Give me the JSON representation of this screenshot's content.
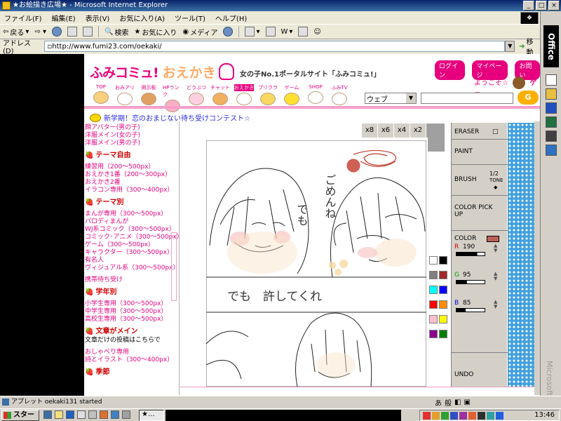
{
  "window": {
    "title": "★お絵描き広場★ - Microsoft Internet Explorer",
    "min": "_",
    "max": "□",
    "close": "×"
  },
  "menu": [
    "ファイル(F)",
    "編集(E)",
    "表示(V)",
    "お気に入り(A)",
    "ツール(T)",
    "ヘルプ(H)"
  ],
  "toolbar": {
    "back": "戻る",
    "search": "検索",
    "favorites": "お気に入り",
    "media": "メディア"
  },
  "address": {
    "label": "アドレス(D)",
    "url": "http://www.fumi23.com/oekaki/",
    "go": "移動"
  },
  "site": {
    "logo_main": "ふみコミュ!",
    "logo_sub": "おえかき",
    "tagline": "女の子No.1ポータルサイト「ふみコミュ!」",
    "top_links": [
      "ログイン",
      "マイページ",
      "お問い"
    ],
    "welcome": "ようこそ☆",
    "welcome_name": "ゲス",
    "nav": [
      "TOP",
      "おみアリ",
      "掲示板",
      "HPランク",
      "どうぶつ",
      "チャット",
      "おえかき",
      "プリクラ",
      "ゲーム",
      "SHOP",
      "ふみTV"
    ],
    "search_select": "ウェブ",
    "search_button": "G",
    "news": "新学期！恋のおまじない待ち受けコンテスト☆"
  },
  "sidebar": {
    "links_top": [
      "顔アバター(男の子)",
      "洋服メイン(女の子)",
      "洋服メイン(男の子)"
    ],
    "sections": [
      {
        "title": "テーマ自由",
        "items": [
          "練習用（200〜500px）",
          "おえかき1番（200〜300px）",
          "おえかき2番",
          "イラコン専用（300〜400px）"
        ]
      },
      {
        "title": "テーマ別",
        "items": [
          "まんが専用（300〜500px）",
          "パロディまんが",
          "WJ系コミック（300〜500px）",
          "コミック･アニメ（300〜500px）",
          "ゲーム（300〜500px）",
          "キャラクター（300〜500px）",
          "有名人",
          "ヴィジュアル系（300〜500px）"
        ]
      },
      {
        "title": "",
        "items": [
          "携帯待ち受け"
        ]
      },
      {
        "title": "学年別",
        "items": [
          "小学生専用（300〜500px）",
          "中学生専用（300〜500px）",
          "高校生専用（300〜500px）"
        ]
      },
      {
        "title": "文章がメイン",
        "note": "文章だけの投稿はこちらで",
        "items": [
          "おしゃべり専用",
          "詩とイラスト（300〜400px）"
        ]
      },
      {
        "title": "季節"
      }
    ]
  },
  "oekaki": {
    "zoom": [
      "x8",
      "x6",
      "x4",
      "x2",
      "x1"
    ],
    "zoom_selected": "x1",
    "drawing_text": {
      "vertical_left": "でも",
      "vertical_right": "ごめんね",
      "bottom": "でも　許してくれ"
    },
    "tools": {
      "eraser": "ERASER",
      "eraser_mark": "□",
      "paint": "PAINT",
      "brush": "BRUSH",
      "brush_sizes": "1/2",
      "tone": "TONE",
      "color_pick": "COLOR PICK UP",
      "color": "COLOR",
      "r_label": "R",
      "r_value": "190",
      "g_label": "G",
      "g_value": "95",
      "b_label": "B",
      "b_value": "85",
      "undo": "UNDO"
    },
    "current_color": "#be5f55",
    "palette": [
      [
        "#ffffff",
        "#000000"
      ],
      [
        "#808080",
        "#a02828"
      ],
      [
        "#00ffff",
        "#0000ff"
      ],
      [
        "#ff0000",
        "#ff8c00"
      ],
      [
        "#ffc0cb",
        "#ffff00"
      ],
      [
        "#8b008b",
        "#008000"
      ]
    ]
  },
  "status": {
    "text": "アプレット oekaki131 started"
  },
  "taskbar": {
    "start": "スタート",
    "task1": "★...",
    "clock": "13:46"
  },
  "office": {
    "label": "Office",
    "brand": "Microsoft"
  }
}
